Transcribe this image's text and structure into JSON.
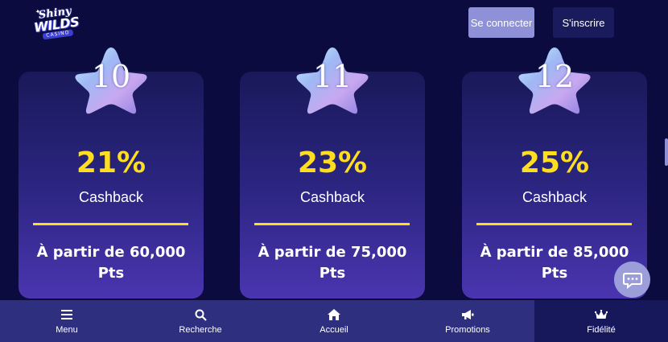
{
  "header": {
    "logo": {
      "line1": "Shiny",
      "line2": "WILDS",
      "line3": "CASINO"
    },
    "login_label": "Se connecter",
    "signup_label": "S'inscrire"
  },
  "levels": [
    {
      "level": "10",
      "cashback_pct": "21%",
      "cashback_label": "Cashback",
      "threshold_line1": "À partir de 60,000",
      "threshold_line2": "Pts"
    },
    {
      "level": "11",
      "cashback_pct": "23%",
      "cashback_label": "Cashback",
      "threshold_line1": "À partir de 75,000",
      "threshold_line2": "Pts"
    },
    {
      "level": "12",
      "cashback_pct": "25%",
      "cashback_label": "Cashback",
      "threshold_line1": "À partir de 85,000",
      "threshold_line2": "Pts"
    }
  ],
  "nav": {
    "items": [
      {
        "label": "Menu",
        "icon": "hamburger-icon"
      },
      {
        "label": "Recherche",
        "icon": "search-icon"
      },
      {
        "label": "Accueil",
        "icon": "home-icon"
      },
      {
        "label": "Promotions",
        "icon": "megaphone-icon"
      },
      {
        "label": "Fidélité",
        "icon": "crown-icon"
      }
    ],
    "active": "Fidélité"
  },
  "colors": {
    "background": "#0b0b3f",
    "accent_yellow": "#ffdd1f",
    "login_button": "#8f91d8",
    "nav_bar": "#2e2f7e",
    "nav_active": "#17185c"
  }
}
